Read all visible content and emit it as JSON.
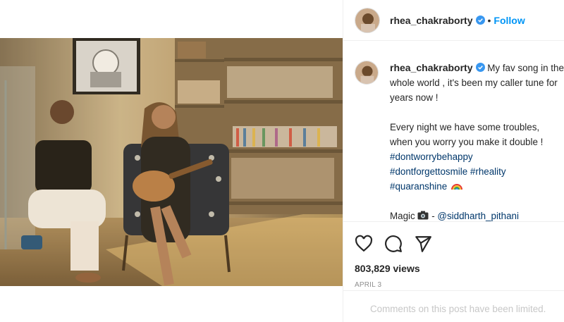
{
  "post": {
    "username": "rhea_chakraborty",
    "follow_label": "Follow",
    "separator": "•",
    "caption_line1": "My fav song in the whole world , it's been my caller tune for years now !",
    "caption_line2": "Every night we have some troubles, when you worry you make it double !",
    "hashtags": [
      "#dontworrybehappy",
      "#dontforgettosmile",
      "#rheality",
      "#quaranshine"
    ],
    "magic_prefix": "Magic",
    "magic_suffix": " - ",
    "mention": "@siddharth_pithani",
    "views": "803,829 views",
    "date": "APRIL 3",
    "comments_note": "Comments on this post have been limited."
  },
  "colors": {
    "accent": "#0095f6",
    "hashtag": "#00376b",
    "verified": "#3897f0"
  },
  "icons": [
    "heart-icon",
    "comment-icon",
    "share-icon",
    "verified-badge-icon",
    "camera-emoji",
    "rainbow-emoji"
  ]
}
